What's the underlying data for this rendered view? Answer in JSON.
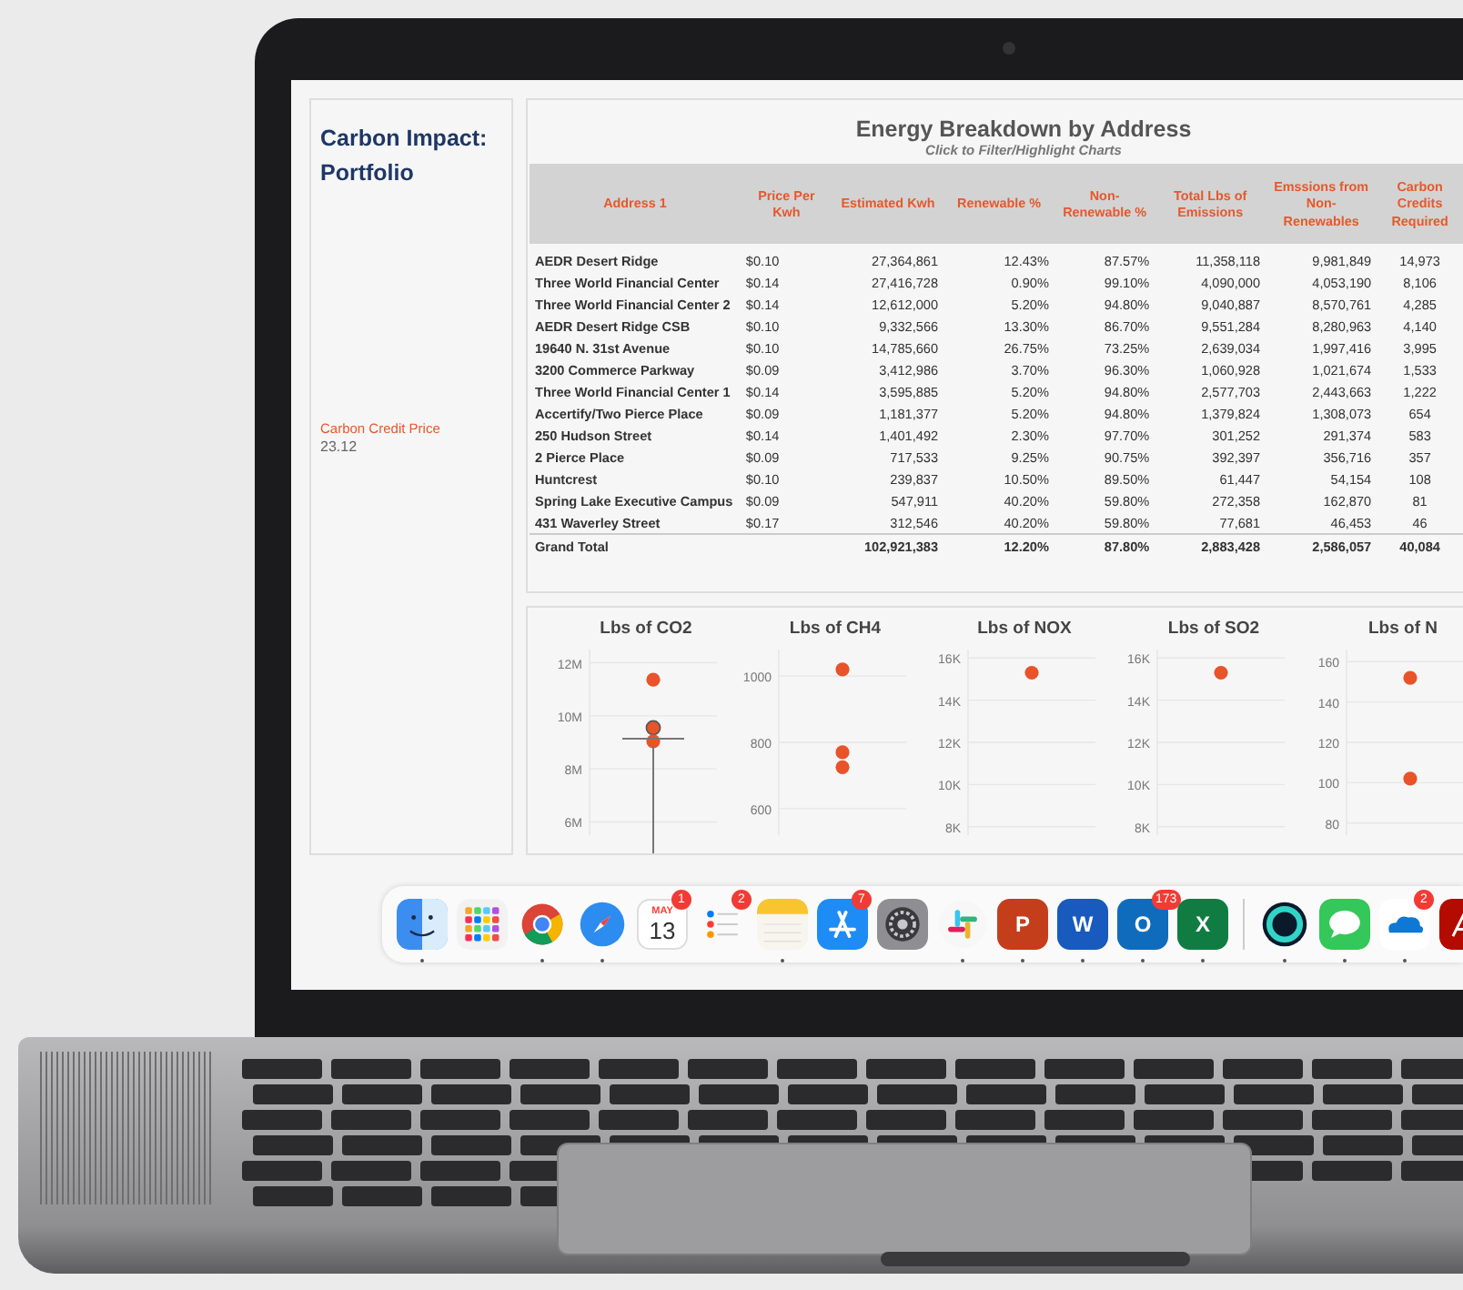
{
  "sidebar": {
    "title": "Carbon Impact: Portfolio",
    "parameter_label": "Carbon Credit Price",
    "parameter_value": "23.12"
  },
  "table": {
    "title": "Energy Breakdown by Address",
    "subtitle": "Click to Filter/Highlight Charts",
    "columns": [
      "Address 1",
      "Price Per Kwh",
      "Estimated Kwh",
      "Renewable %",
      "Non-Renewable %",
      "Total Lbs of Emissions",
      "Emssions from Non-Renewables",
      "Carbon Credits Required"
    ],
    "rows": [
      [
        "AEDR Desert Ridge",
        "$0.10",
        "27,364,861",
        "12.43%",
        "87.57%",
        "11,358,118",
        "9,981,849",
        "14,973"
      ],
      [
        "Three World Financial Center",
        "$0.14",
        "27,416,728",
        "0.90%",
        "99.10%",
        "4,090,000",
        "4,053,190",
        "8,106"
      ],
      [
        "Three World Financial Center 2",
        "$0.14",
        "12,612,000",
        "5.20%",
        "94.80%",
        "9,040,887",
        "8,570,761",
        "4,285"
      ],
      [
        "AEDR Desert Ridge CSB",
        "$0.10",
        "9,332,566",
        "13.30%",
        "86.70%",
        "9,551,284",
        "8,280,963",
        "4,140"
      ],
      [
        "19640 N. 31st Avenue",
        "$0.10",
        "14,785,660",
        "26.75%",
        "73.25%",
        "2,639,034",
        "1,997,416",
        "3,995"
      ],
      [
        "3200 Commerce Parkway",
        "$0.09",
        "3,412,986",
        "3.70%",
        "96.30%",
        "1,060,928",
        "1,021,674",
        "1,533"
      ],
      [
        "Three World Financial Center 1",
        "$0.14",
        "3,595,885",
        "5.20%",
        "94.80%",
        "2,577,703",
        "2,443,663",
        "1,222"
      ],
      [
        "Accertify/Two Pierce Place",
        "$0.09",
        "1,181,377",
        "5.20%",
        "94.80%",
        "1,379,824",
        "1,308,073",
        "654"
      ],
      [
        "250 Hudson Street",
        "$0.14",
        "1,401,492",
        "2.30%",
        "97.70%",
        "301,252",
        "291,374",
        "583"
      ],
      [
        "2 Pierce Place",
        "$0.09",
        "717,533",
        "9.25%",
        "90.75%",
        "392,397",
        "356,716",
        "357"
      ],
      [
        "Huntcrest",
        "$0.10",
        "239,837",
        "10.50%",
        "89.50%",
        "61,447",
        "54,154",
        "108"
      ],
      [
        "Spring Lake Executive Campus",
        "$0.09",
        "547,911",
        "40.20%",
        "59.80%",
        "272,358",
        "162,870",
        "81"
      ],
      [
        "431 Waverley Street",
        "$0.17",
        "312,546",
        "40.20%",
        "59.80%",
        "77,681",
        "46,453",
        "46"
      ]
    ],
    "total": {
      "label": "Grand Total",
      "cells": [
        "102,921,383",
        "12.20%",
        "87.80%",
        "2,883,428",
        "2,586,057",
        "40,084"
      ]
    }
  },
  "charts": [
    {
      "chart_data": {
        "type": "scatter",
        "title": "Lbs of CO2",
        "grid": true,
        "categories": [
          null
        ],
        "ylim": [
          5500000,
          12500000
        ],
        "yticks": [
          {
            "value": 6000000,
            "label": "6M"
          },
          {
            "value": 8000000,
            "label": "8M"
          },
          {
            "value": 10000000,
            "label": "10M"
          },
          {
            "value": 12000000,
            "label": "12M"
          }
        ],
        "series": [
          {
            "color": "#e8532a",
            "values": [
              11360000
            ]
          },
          {
            "color": "#e8532a",
            "values": [
              9550000
            ]
          },
          {
            "color": "#e8532a",
            "values": [
              9040000
            ]
          }
        ]
      },
      "point_selected": [
        false,
        true,
        false
      ]
    },
    {
      "chart_data": {
        "type": "scatter",
        "title": "Lbs of CH4",
        "grid": true,
        "categories": [
          null
        ],
        "ylim": [
          520,
          1080
        ],
        "yticks": [
          {
            "value": 600,
            "label": "600"
          },
          {
            "value": 800,
            "label": "800"
          },
          {
            "value": 1000,
            "label": "1000"
          }
        ],
        "series": [
          {
            "color": "#e8532a",
            "values": [
              1020
            ]
          },
          {
            "color": "#e8532a",
            "values": [
              770
            ]
          },
          {
            "color": "#e8532a",
            "values": [
              725
            ]
          }
        ]
      }
    },
    {
      "chart_data": {
        "type": "scatter",
        "title": "Lbs of NOX",
        "grid": true,
        "categories": [
          null
        ],
        "ylim": [
          7600,
          16400
        ],
        "yticks": [
          {
            "value": 8000,
            "label": "8K"
          },
          {
            "value": 10000,
            "label": "10K"
          },
          {
            "value": 12000,
            "label": "12K"
          },
          {
            "value": 14000,
            "label": "14K"
          },
          {
            "value": 16000,
            "label": "16K"
          }
        ],
        "series": [
          {
            "color": "#e8532a",
            "values": [
              15300
            ]
          }
        ]
      }
    },
    {
      "chart_data": {
        "type": "scatter",
        "title": "Lbs of SO2",
        "grid": true,
        "categories": [
          null
        ],
        "ylim": [
          7600,
          16400
        ],
        "yticks": [
          {
            "value": 8000,
            "label": "8K"
          },
          {
            "value": 10000,
            "label": "10K"
          },
          {
            "value": 12000,
            "label": "12K"
          },
          {
            "value": 14000,
            "label": "14K"
          },
          {
            "value": 16000,
            "label": "16K"
          }
        ],
        "series": [
          {
            "color": "#e8532a",
            "values": [
              15300
            ]
          }
        ]
      }
    },
    {
      "chart_data": {
        "type": "scatter",
        "title": "Lbs of N",
        "grid": true,
        "categories": [
          null
        ],
        "ylim": [
          74,
          166
        ],
        "yticks": [
          {
            "value": 80,
            "label": "80"
          },
          {
            "value": 100,
            "label": "100"
          },
          {
            "value": 120,
            "label": "120"
          },
          {
            "value": 140,
            "label": "140"
          },
          {
            "value": 160,
            "label": "160"
          }
        ],
        "series": [
          {
            "color": "#e8532a",
            "values": [
              152
            ]
          },
          {
            "color": "#e8532a",
            "values": [
              102
            ]
          }
        ]
      }
    }
  ],
  "dock": [
    {
      "kind": "finder",
      "running": true
    },
    {
      "kind": "launchpad",
      "running": false
    },
    {
      "kind": "chrome",
      "running": true
    },
    {
      "kind": "safari",
      "running": true
    },
    {
      "kind": "calendar",
      "month": "MAY",
      "day": "13",
      "badge": "1",
      "running": false
    },
    {
      "kind": "reminders",
      "badge": "2",
      "running": false
    },
    {
      "kind": "notes",
      "running": true
    },
    {
      "kind": "appstore",
      "badge": "7",
      "running": false
    },
    {
      "kind": "settings",
      "running": false
    },
    {
      "kind": "slack",
      "running": true
    },
    {
      "kind": "office",
      "letter": "P",
      "color": "#c43e1c",
      "running": true
    },
    {
      "kind": "office",
      "letter": "W",
      "color": "#185abd",
      "running": true
    },
    {
      "kind": "office",
      "letter": "O",
      "color": "#0f6cbd",
      "badge": "173",
      "running": true
    },
    {
      "kind": "office",
      "letter": "X",
      "color": "#107c41",
      "running": true
    },
    {
      "kind": "separator"
    },
    {
      "kind": "webex",
      "running": true
    },
    {
      "kind": "messages",
      "running": true
    },
    {
      "kind": "onedrive",
      "badge": "2",
      "running": true
    },
    {
      "kind": "acrobat"
    }
  ]
}
